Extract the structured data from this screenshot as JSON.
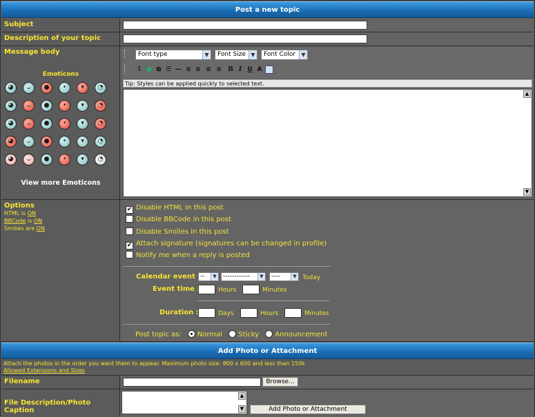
{
  "header": {
    "title": "Post a new topic"
  },
  "fields": {
    "subject_label": "Subject",
    "description_label": "Description of your topic",
    "message_label": "Message body"
  },
  "emoticons": {
    "title": "Emoticons",
    "more_link": "View more Emoticons",
    "colors": [
      "b",
      "b",
      "r",
      "b",
      "r",
      "b",
      "b",
      "r",
      "b",
      "r",
      "b",
      "r",
      "b",
      "r",
      "b",
      "r",
      "b",
      "r",
      "r",
      "b",
      "r",
      "b",
      "b",
      "b",
      "p",
      "p",
      "b",
      "r",
      "b",
      "w"
    ]
  },
  "editor": {
    "font_type": "Font type",
    "font_size": "Font Size",
    "font_color": "Font Color",
    "tip": "Tip: Styles can be applied quickly to selected text."
  },
  "options": {
    "title": "Options",
    "html_label": "HTML is",
    "html_status": "ON",
    "bbcode_label": "BBCode",
    "bbcode_is": "is",
    "bbcode_status": "ON",
    "smilies_label": "Smilies are",
    "smilies_status": "ON",
    "checkboxes": [
      {
        "label": "Disable HTML in this post",
        "checked": true
      },
      {
        "label": "Disable BBCode in this post",
        "checked": false
      },
      {
        "label": "Disable Smilies in this post",
        "checked": false
      },
      {
        "label": "Attach signature (signatures can be changed in profile)",
        "checked": true
      },
      {
        "label": "Notify me when a reply is posted",
        "checked": false
      }
    ]
  },
  "calendar": {
    "event_label": "Calendar event :",
    "day": "--",
    "month": "------------",
    "year": "----",
    "today": "Today",
    "time_label": "Event time :",
    "hours": "Hours",
    "minutes": "Minutes",
    "duration_label": "Duration :",
    "days": "Days"
  },
  "post_as": {
    "label": "Post topic as:",
    "normal": "Normal",
    "sticky": "Sticky",
    "announcement": "Announcement"
  },
  "attachment": {
    "title": "Add Photo or Attachment",
    "note": "Attach the photos in the order you want them to appear. Maximum photo size: 800 x 600 and less than 150k",
    "extensions_link": "Allowed Extensions and Sizes",
    "filename_label": "Filename",
    "browse": "Browse...",
    "caption_label": "File Description/Photo Caption",
    "add_button": "Add Photo or Attachment"
  }
}
